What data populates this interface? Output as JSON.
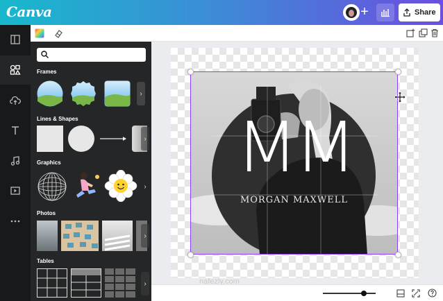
{
  "app": {
    "logo": "Canva"
  },
  "header": {
    "share_label": "Share"
  },
  "sidebar": {
    "items": [
      {
        "icon": "layout-icon"
      },
      {
        "icon": "elements-icon"
      },
      {
        "icon": "upload-icon"
      },
      {
        "icon": "text-icon"
      },
      {
        "icon": "music-icon"
      },
      {
        "icon": "video-icon"
      },
      {
        "icon": "more-icon"
      }
    ]
  },
  "panel": {
    "search_placeholder": "",
    "sections": [
      {
        "title": "Frames"
      },
      {
        "title": "Lines & Shapes"
      },
      {
        "title": "Graphics"
      },
      {
        "title": "Photos"
      },
      {
        "title": "Tables"
      }
    ]
  },
  "design": {
    "monogram": "MM",
    "name": "MORGAN MAXWELL"
  },
  "zoom": {
    "level": 0.78
  },
  "watermark": {
    "text": "nafezly.com"
  },
  "colors": {
    "accent": "#8b3dff",
    "panel_bg": "#252627",
    "rail_bg": "#18191b"
  }
}
